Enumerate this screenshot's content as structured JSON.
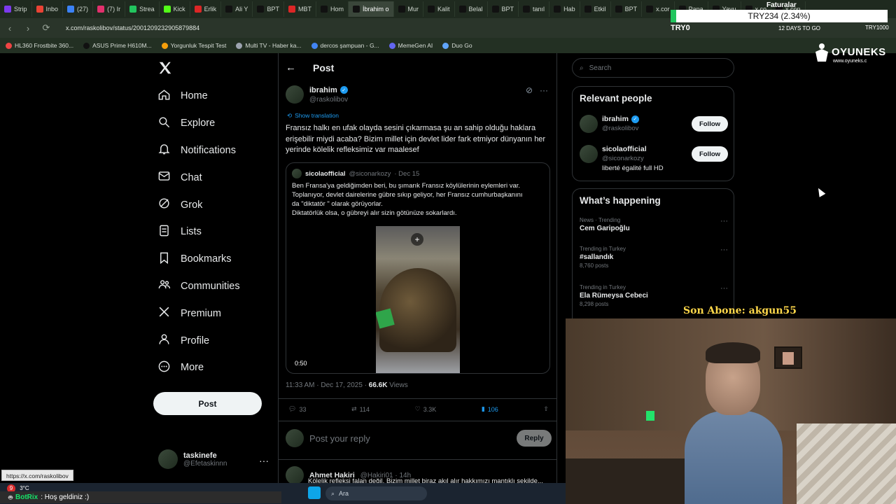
{
  "browser": {
    "tabs": [
      {
        "label": "Strip",
        "color": "#7c3aed"
      },
      {
        "label": "Inbo",
        "color": "#ea4335"
      },
      {
        "label": "(27)",
        "color": "#3b82f6"
      },
      {
        "label": "(7) Ir",
        "color": "#e1306c"
      },
      {
        "label": "Strea",
        "color": "#22c55e"
      },
      {
        "label": "Kick",
        "color": "#53fc18"
      },
      {
        "label": "Erlik",
        "color": "#dc2626"
      },
      {
        "label": "Ali Y",
        "color": "#111111"
      },
      {
        "label": "BPT",
        "color": "#111111"
      },
      {
        "label": "MBT",
        "color": "#dc2626"
      },
      {
        "label": "Hom",
        "color": "#111111"
      },
      {
        "label": "İbrahim o",
        "color": "#111111",
        "active": true
      },
      {
        "label": "Mur",
        "color": "#111111"
      },
      {
        "label": "Kalit",
        "color": "#111111"
      },
      {
        "label": "Belal",
        "color": "#111111"
      },
      {
        "label": "BPT",
        "color": "#111111"
      },
      {
        "label": "tanıl",
        "color": "#111111"
      },
      {
        "label": "Hab",
        "color": "#111111"
      },
      {
        "label": "Etkil",
        "color": "#111111"
      },
      {
        "label": "BPT",
        "color": "#111111"
      },
      {
        "label": "x.cor",
        "color": "#111111"
      },
      {
        "label": "Papa",
        "color": "#111111"
      },
      {
        "label": "Yavu",
        "color": "#111111"
      },
      {
        "label": "x.co",
        "color": "#111111"
      },
      {
        "label": "x.con",
        "color": "#111111"
      }
    ],
    "url": "x.com/raskolibov/status/2001209232905879884",
    "bookmarks": [
      {
        "label": "HL360 Frostbite 360...",
        "color": "#ef4444"
      },
      {
        "label": "ASUS Prime H610M...",
        "color": "#111111"
      },
      {
        "label": "Yorgunluk Tespit Test",
        "color": "#f59e0b"
      },
      {
        "label": "Multi TV - Haber ka...",
        "color": "#9ca3af"
      },
      {
        "label": "dercos şampuan - G...",
        "color": "#4285f4"
      },
      {
        "label": "MemeGen AI",
        "color": "#6366f1"
      },
      {
        "label": "Duo Go",
        "color": "#60a5fa"
      }
    ],
    "status_url": "https://x.com/raskolibov"
  },
  "stream_overlay": {
    "faturalar": "Faturalar",
    "ticker": "TRY234 (2.34%)",
    "try0": "TRY0",
    "days_to_go": "12 DAYS TO GO",
    "try_right": "TRY1000",
    "brand": "OYUNEKS",
    "brand_url": "www.oyuneks.c",
    "last_sub": "Son Abone: akgun55",
    "chat_user": "BotRix",
    "chat_message": ": Hoş geldiniz :)",
    "weather_badge": "9",
    "weather_temp": "3°C",
    "taskbar_search": "Ara"
  },
  "sidebar": {
    "items": [
      {
        "label": "Home",
        "icon": "home-icon"
      },
      {
        "label": "Explore",
        "icon": "search-icon"
      },
      {
        "label": "Notifications",
        "icon": "bell-icon"
      },
      {
        "label": "Chat",
        "icon": "mail-icon"
      },
      {
        "label": "Grok",
        "icon": "grok-icon"
      },
      {
        "label": "Lists",
        "icon": "list-icon"
      },
      {
        "label": "Bookmarks",
        "icon": "bookmark-icon"
      },
      {
        "label": "Communities",
        "icon": "people-icon"
      },
      {
        "label": "Premium",
        "icon": "x-icon"
      },
      {
        "label": "Profile",
        "icon": "person-icon"
      },
      {
        "label": "More",
        "icon": "more-icon"
      }
    ],
    "post_button": "Post",
    "me": {
      "name": "taskinefe",
      "handle": "@Efetaskinnn"
    }
  },
  "post": {
    "header_title": "Post",
    "author_name": "ibrahim",
    "author_handle": "@raskolibov",
    "show_translation": "Show translation",
    "text": "Fransız halkı en ufak olayda sesini çıkarmasa şu an sahip olduğu haklara erişebilir miydi acaba? Bizim millet için devlet lider fark etmiyor dünyanın her yerinde kölelik refleksimiz var maalesef",
    "quote": {
      "name": "sicolaofficial",
      "handle": "@siconarkozy",
      "date": "· Dec 15",
      "text_lines": [
        "Ben Fransa'ya geldiğimden beri, bu şımarık Fransız köylülerinin eylemleri var.",
        "Toplanıyor, devlet dairelerine gübre sıkıp geliyor,  her Fransız cumhurbaşkanını",
        "da \"diktatör \" olarak görüyorlar.",
        "Diktatörlük olsa, o gübreyi alır sizin götünüze sokarlardı."
      ],
      "video_time": "0:50"
    },
    "timestamp": "11:33 AM · Dec 17, 2025 ·",
    "views_count": "66.6K",
    "views_label": "Views",
    "replies": "33",
    "reposts": "114",
    "likes": "3.3K",
    "bookmarks": "106",
    "reply_placeholder": "Post your reply",
    "reply_button": "Reply"
  },
  "comment": {
    "name": "Ahmet Hakiri",
    "handle": "@Hakiri01 · 14h",
    "text": "Kölelik refleksi falan değil. Bizim millet biraz akıl alır hakkımızı mantıklı şekilde..."
  },
  "right": {
    "search_placeholder": "Search",
    "relevant_title": "Relevant people",
    "people": [
      {
        "name": "ibrahim",
        "handle": "@raskolibov",
        "bio": "",
        "verified": true,
        "button": "Follow"
      },
      {
        "name": "sicolaofficial",
        "handle": "@siconarkozy",
        "bio": "liberté égalité full HD",
        "verified": false,
        "button": "Follow"
      }
    ],
    "happening_title": "What’s happening",
    "trends": [
      {
        "context": "News · Trending",
        "topic": "Cem Garipoğlu",
        "count": ""
      },
      {
        "context": "Trending in Turkey",
        "topic": "#sallandık",
        "count": "8,760 posts"
      },
      {
        "context": "Trending in Turkey",
        "topic": "Ela Rümeysa Cebeci",
        "count": "8,298 posts"
      }
    ]
  }
}
